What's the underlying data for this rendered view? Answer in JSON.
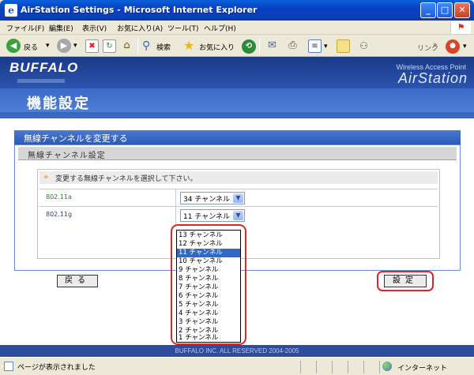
{
  "window": {
    "title": "AirStation Settings - Microsoft Internet Explorer"
  },
  "menu": [
    "ファイル(F)",
    "編集(E)",
    "表示(V)",
    "お気に入り(A)",
    "ツール(T)",
    "ヘルプ(H)"
  ],
  "toolbar": {
    "back_label": "戻る",
    "search_label": "検索",
    "favorites_label": "お気に入り",
    "links_label": "リンク"
  },
  "header": {
    "brand": "BUFFALO",
    "product_line": "Wireless Access Point",
    "product": "AirStation",
    "page_title": "機能設定"
  },
  "panel": {
    "heading": "無線チャンネルを変更する",
    "subheading": "無線チャンネル設定",
    "instruction": "変更する無線チャンネルを選択して下さい。",
    "rows": [
      {
        "label": "802.11a",
        "value": "34 チャンネル"
      },
      {
        "label": "802.11g",
        "value": "11 チャンネル"
      }
    ]
  },
  "dropdown_options": [
    "13 チャンネル",
    "12 チャンネル",
    "11 チャンネル",
    "10 チャンネル",
    "9 チャンネル",
    "8 チャンネル",
    "7 チャンネル",
    "6 チャンネル",
    "5 チャンネル",
    "4 チャンネル",
    "3 チャンネル",
    "2 チャンネル",
    "1 チャンネル"
  ],
  "selected_option": "11 チャンネル",
  "buttons": {
    "back": "戻る",
    "set": "設定"
  },
  "footer": "BUFFALO INC. ALL RESERVED 2004-2005",
  "status": {
    "text": "ページが表示されました",
    "zone": "インターネット"
  },
  "colors": {
    "highlight": "#e8202a",
    "selection": "#316ac5",
    "header_blue": "#2c56b4"
  }
}
